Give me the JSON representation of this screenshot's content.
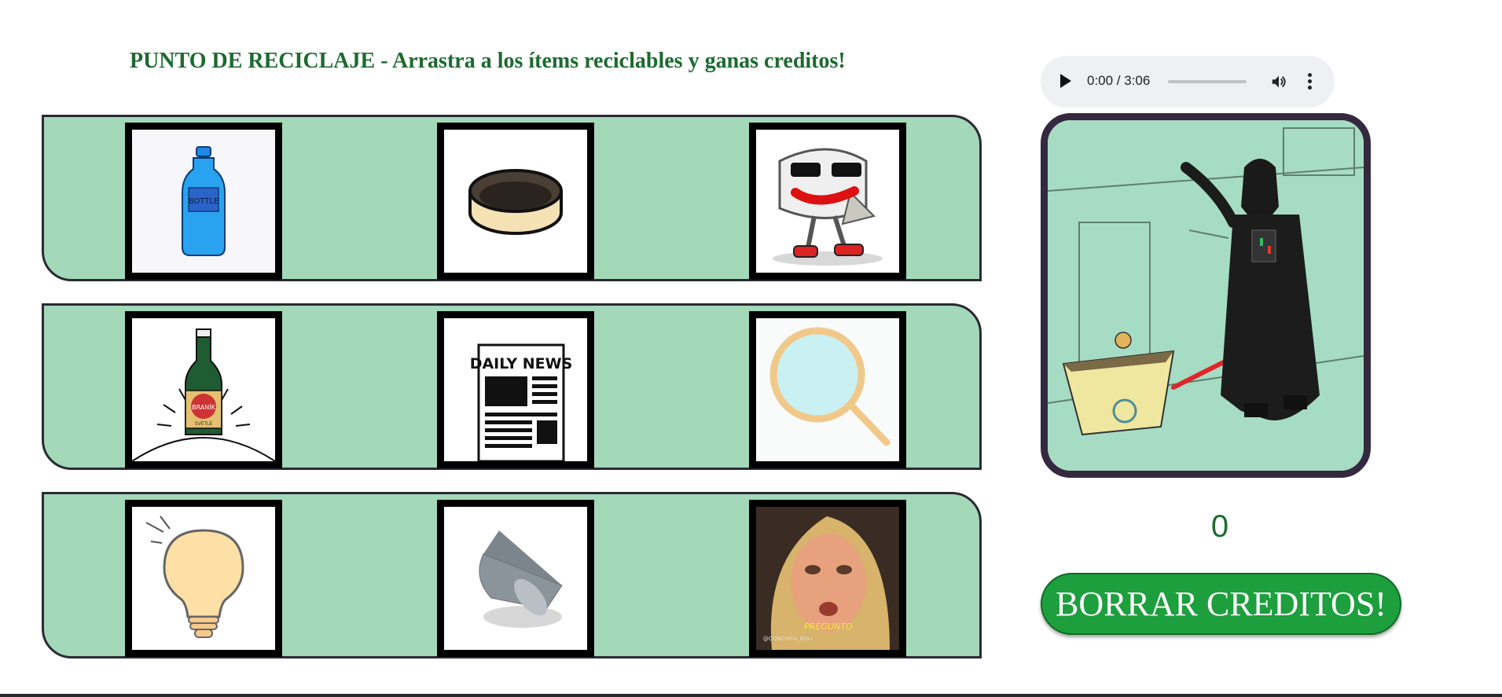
{
  "title": "PUNTO DE RECICLAJE - Arrastra a los ítems reciclables y ganas creditos!",
  "audio": {
    "time": "0:00 / 3:06",
    "play_icon": "play-icon",
    "volume_icon": "volume-icon",
    "menu_icon": "more-vert-icon"
  },
  "items": [
    {
      "name": "plastic-bottle",
      "label": "BOTTLE"
    },
    {
      "name": "tin-can"
    },
    {
      "name": "toilet-paper-character"
    },
    {
      "name": "beer-bottle",
      "label": "BRANÍK",
      "sublabel": "SVĚTLÉ"
    },
    {
      "name": "newspaper",
      "label": "DAILY NEWS"
    },
    {
      "name": "mirror"
    },
    {
      "name": "light-bulb"
    },
    {
      "name": "tape-roll"
    },
    {
      "name": "woman-photo",
      "caption": "PREGUNTO",
      "watermark": "@CONCHITA_POLI"
    }
  ],
  "credits": {
    "value": "0"
  },
  "clear_button": {
    "label": "BORRAR CREDITOS!"
  },
  "colors": {
    "row_bg": "#a3d8b9",
    "title": "#1d6a2f",
    "button": "#1d9f3d",
    "frame": "#35293f"
  }
}
